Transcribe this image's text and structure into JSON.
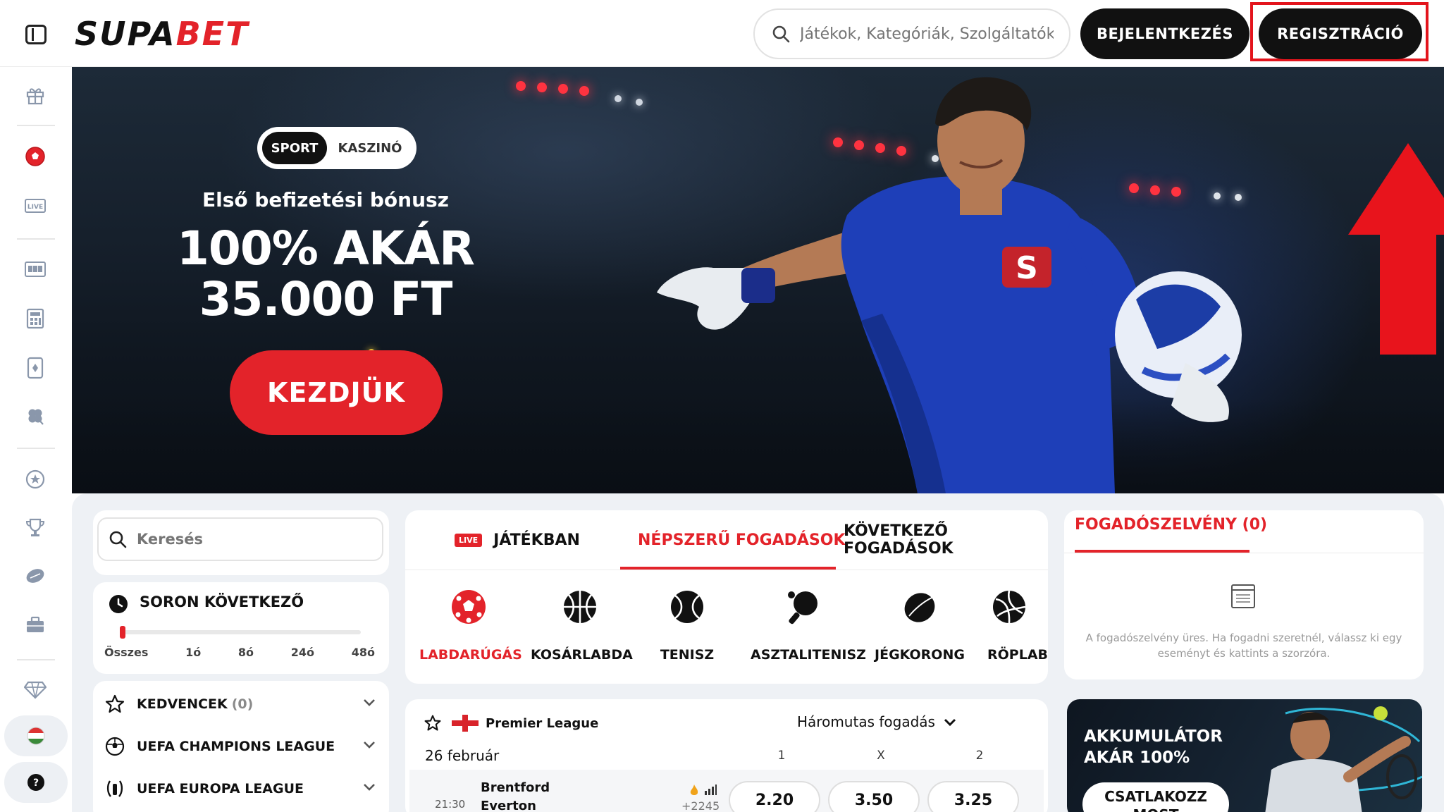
{
  "header": {
    "logo_part1": "SUPA",
    "logo_part2": "BET",
    "search_placeholder": "Játékok, Kategóriák, Szolgáltatók",
    "login_label": "BEJELENTKEZÉS",
    "register_label": "REGISZTRÁCIÓ"
  },
  "sidebar": {
    "icons": [
      "gift-icon",
      "soccer-ball-icon",
      "live-icon",
      "slot-machine-icon",
      "calculator-icon",
      "card-icon",
      "clover-icon",
      "star-badge-icon",
      "trophy-icon",
      "rugby-icon",
      "briefcase-icon",
      "diamond-icon",
      "hungary-flag-icon",
      "help-icon"
    ],
    "live_text": "LIVE",
    "help_text": "?"
  },
  "hero": {
    "toggle_sport": "SPORT",
    "toggle_casino": "KASZINÓ",
    "subtitle": "Első befizetési bónusz",
    "title_line1": "100% AKÁR",
    "title_line2": "35.000 FT",
    "cta_label": "KEZDJÜK",
    "jersey_letter": "S"
  },
  "left_panel": {
    "search_placeholder": "Keresés",
    "next_title": "SORON KÖVETKEZŐ",
    "ticks": [
      "Összes",
      "1ó",
      "8ó",
      "24ó",
      "48ó"
    ],
    "favorites_label": "KEDVENCEK",
    "favorites_count": "(0)",
    "leagues": [
      "UEFA CHAMPIONS LEAGUE",
      "UEFA EUROPA LEAGUE"
    ]
  },
  "main": {
    "tabs": [
      {
        "label": "JÁTÉKBAN",
        "live_badge": "LIVE"
      },
      {
        "label": "NÉPSZERŰ FOGADÁSOK"
      },
      {
        "label": "KÖVETKEZŐ FOGADÁSOK"
      }
    ],
    "sports": [
      "LABDARÚGÁS",
      "KOSÁRLABDA",
      "TENISZ",
      "ASZTALITENISZ",
      "JÉGKORONG",
      "RÖPLAB"
    ],
    "match": {
      "league": "Premier League",
      "bet_type": "Háromutas fogadás",
      "date": "26 február",
      "col_1": "1",
      "col_x": "X",
      "col_2": "2",
      "time": "21:30",
      "home": "Brentford",
      "away": "Everton",
      "more_markets": "+2245",
      "odd_1": "2.20",
      "odd_x": "3.50",
      "odd_2": "3.25"
    }
  },
  "bet_slip": {
    "title": "FOGADÓSZELVÉNY (0)",
    "empty_text": "A fogadószelvény üres. Ha fogadni szeretnél, válassz ki egy eseményt és kattints a szorzóra."
  },
  "promo": {
    "title": "AKKUMULÁTOR AKÁR 100%",
    "button_label": "CSATLAKOZZ MOST"
  },
  "colors": {
    "brand_red": "#e3232a",
    "dark": "#111111",
    "panel_bg": "#eef1f5"
  }
}
